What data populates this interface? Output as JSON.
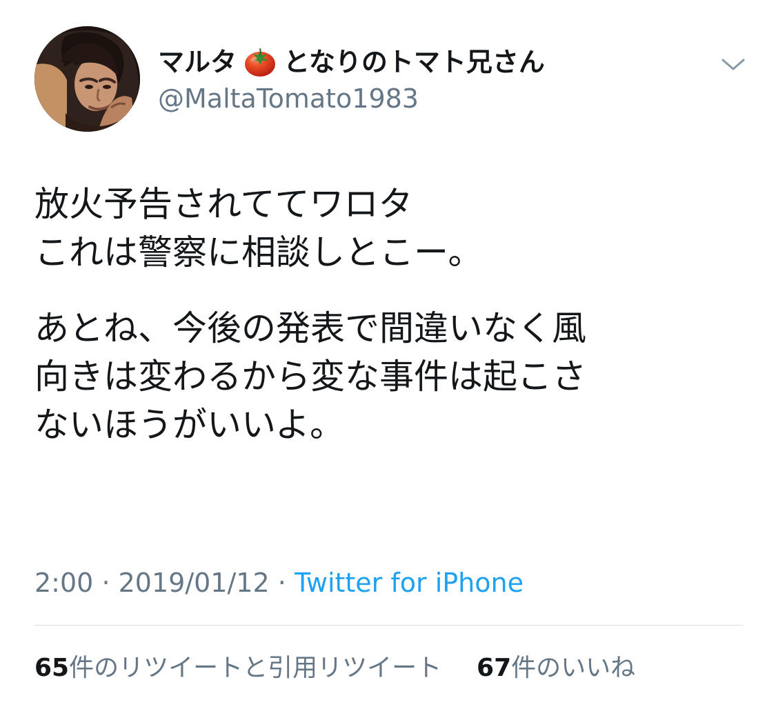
{
  "user": {
    "display_name_prefix": "マルタ",
    "display_name_suffix": "となりのトマト兄さん",
    "handle": "@MaltaTomato1983",
    "emoji_icon": "tomato-icon"
  },
  "header": {
    "menu_icon": "chevron-down-icon"
  },
  "tweet": {
    "paragraphs": [
      {
        "lines": [
          "放火予告されててワロタ",
          "これは警察に相談しとこー。"
        ]
      },
      {
        "lines": [
          "あとね、今後の発表で間違いなく風",
          "向きは変わるから変な事件は起こさ",
          "ないほうがいいよ。"
        ]
      }
    ],
    "time": "2:00",
    "date": "2019/01/12",
    "separator": "·",
    "source": "Twitter for iPhone"
  },
  "stats": {
    "retweets_count": "65",
    "retweets_label": "件のリツイートと引用リツイート",
    "likes_count": "67",
    "likes_label": "件のいいね"
  },
  "colors": {
    "text": "#14171a",
    "secondary": "#657786",
    "link": "#1da1f2",
    "divider": "#d8dee3"
  }
}
